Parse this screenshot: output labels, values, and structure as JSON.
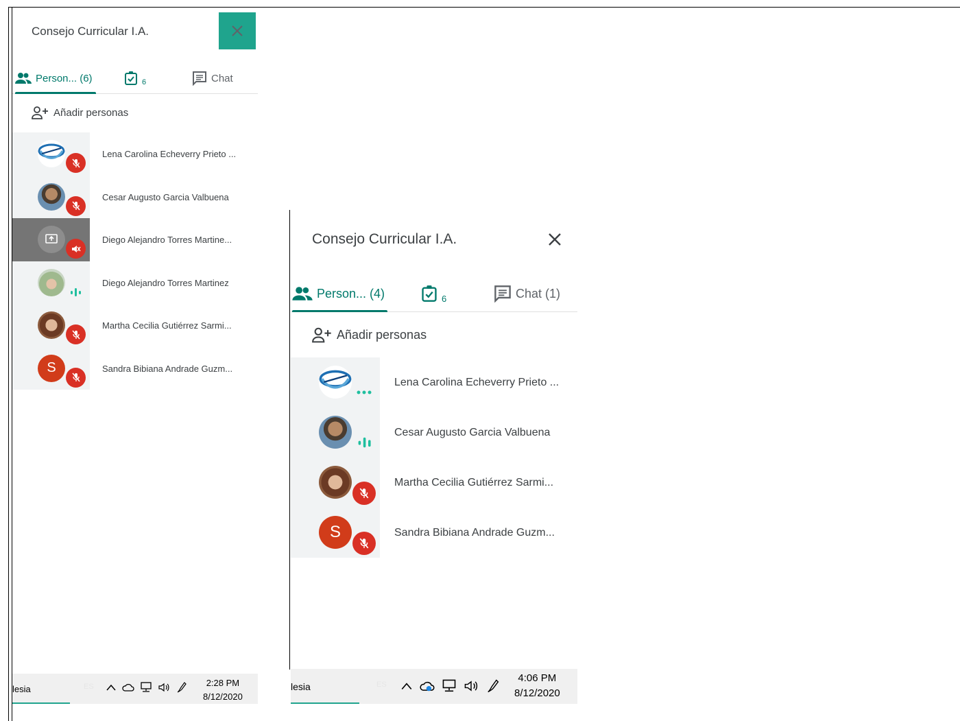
{
  "colors": {
    "accent": "#00796b",
    "mute_red": "#d93025",
    "close_teal": "#1fa48d",
    "avatar_s": "#d13c1a",
    "sound_green": "#1fbf9f"
  },
  "panel1": {
    "title": "Consejo Curricular I.A.",
    "tabs": {
      "people": "Person... (6)",
      "tasks_count": "6",
      "chat": "Chat"
    },
    "add_people": "Añadir personas",
    "participants": [
      {
        "name": "Lena Carolina Echeverry Prieto ...",
        "status": "muted",
        "avatar": "logo-icon"
      },
      {
        "name": "Cesar Augusto Garcia Valbuena",
        "status": "muted",
        "avatar": "photo"
      },
      {
        "name": "Diego Alejandro Torres Martine...",
        "status": "presenting-muted",
        "avatar": "present-icon"
      },
      {
        "name": "Diego Alejandro Torres Martinez",
        "status": "speaking",
        "avatar": "photo"
      },
      {
        "name": "Martha Cecilia Gutiérrez Sarmi...",
        "status": "muted",
        "avatar": "photo"
      },
      {
        "name": "Sandra Bibiana Andrade Guzm...",
        "status": "muted",
        "avatar": "S"
      }
    ],
    "taskbar": {
      "app_text": "lesia",
      "lang": "ES",
      "time": "2:28 PM",
      "date": "8/12/2020"
    }
  },
  "panel2": {
    "title": "Consejo Curricular I.A.",
    "tabs": {
      "people": "Person... (4)",
      "tasks_count": "6",
      "chat": "Chat (1)"
    },
    "add_people": "Añadir personas",
    "participants": [
      {
        "name": "Lena Carolina Echeverry Prieto ...",
        "status": "connecting",
        "avatar": "logo-icon"
      },
      {
        "name": "Cesar Augusto Garcia Valbuena",
        "status": "speaking",
        "avatar": "photo"
      },
      {
        "name": "Martha Cecilia Gutiérrez Sarmi...",
        "status": "muted",
        "avatar": "photo"
      },
      {
        "name": "Sandra Bibiana Andrade Guzm...",
        "status": "muted",
        "avatar": "S"
      }
    ],
    "taskbar": {
      "app_text": "lesia",
      "lang": "ES",
      "time": "4:06 PM",
      "date": "8/12/2020"
    }
  }
}
